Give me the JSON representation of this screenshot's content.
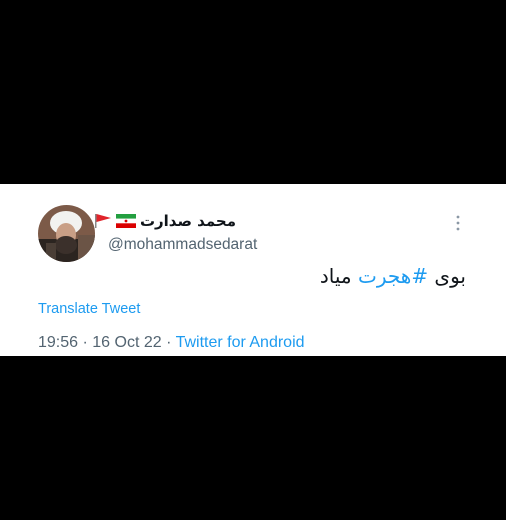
{
  "tweet": {
    "author": {
      "name": "محمد صدارت",
      "handle": "@mohammadsedarat"
    },
    "text": {
      "prefix": "بوی ",
      "hashtag": "#هجرت",
      "suffix": " میاد"
    },
    "translate_label": "Translate Tweet",
    "meta": {
      "time": "19:56",
      "separator": " · ",
      "date": "16 Oct 22",
      "separator2": " · ",
      "source": "Twitter for Android"
    }
  },
  "icons": {
    "flag_icon": "red-triangular-flag",
    "iran_flag_icon": "iran-flag",
    "more_icon": "vertical-ellipsis"
  },
  "colors": {
    "link": "#1d9bf0",
    "text": "#0f1419",
    "secondary": "#536471",
    "background": "#000000",
    "card": "#ffffff"
  }
}
